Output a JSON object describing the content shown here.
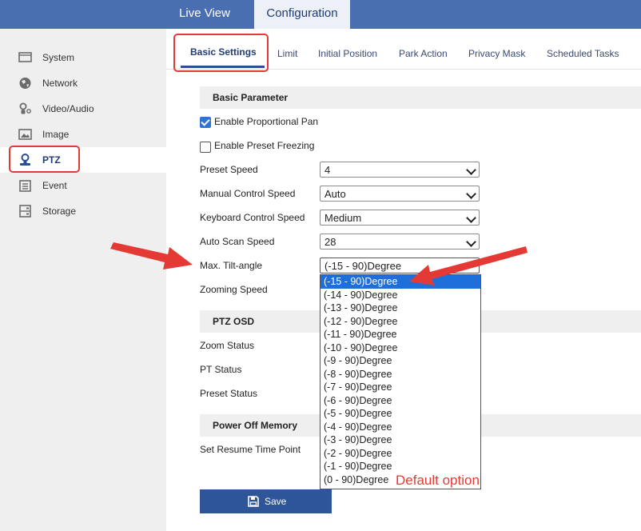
{
  "top_tabs": {
    "live_view": "Live View",
    "configuration": "Configuration"
  },
  "sidebar": {
    "items": [
      {
        "label": "System",
        "icon": "monitor-icon"
      },
      {
        "label": "Network",
        "icon": "globe-icon"
      },
      {
        "label": "Video/Audio",
        "icon": "camera-mic-icon"
      },
      {
        "label": "Image",
        "icon": "image-icon"
      },
      {
        "label": "PTZ",
        "icon": "ptz-icon",
        "active": true
      },
      {
        "label": "Event",
        "icon": "calendar-icon"
      },
      {
        "label": "Storage",
        "icon": "storage-icon"
      }
    ]
  },
  "subtabs": [
    "Basic Settings",
    "Limit",
    "Initial Position",
    "Park Action",
    "Privacy Mask",
    "Scheduled Tasks"
  ],
  "basic_parameter": {
    "title": "Basic Parameter",
    "enable_proportional_pan": {
      "label": "Enable Proportional Pan",
      "checked": true
    },
    "enable_preset_freezing": {
      "label": "Enable Preset Freezing",
      "checked": false
    },
    "preset_speed": {
      "label": "Preset Speed",
      "value": "4"
    },
    "manual_control_speed": {
      "label": "Manual Control Speed",
      "value": "Auto"
    },
    "keyboard_control_speed": {
      "label": "Keyboard Control Speed",
      "value": "Medium"
    },
    "auto_scan_speed": {
      "label": "Auto Scan Speed",
      "value": "28"
    },
    "max_tilt_angle": {
      "label": "Max. Tilt-angle",
      "value": "(-15 - 90)Degree"
    },
    "zooming_speed": {
      "label": "Zooming Speed"
    }
  },
  "tilt_options": [
    "(-15 - 90)Degree",
    "(-14 - 90)Degree",
    "(-13 - 90)Degree",
    "(-12 - 90)Degree",
    "(-11 - 90)Degree",
    "(-10 - 90)Degree",
    "(-9 - 90)Degree",
    "(-8 - 90)Degree",
    "(-7 - 90)Degree",
    "(-6 - 90)Degree",
    "(-5 - 90)Degree",
    "(-4 - 90)Degree",
    "(-3 - 90)Degree",
    "(-2 - 90)Degree",
    "(-1 - 90)Degree",
    "(0 - 90)Degree"
  ],
  "ptz_osd": {
    "title": "PTZ OSD",
    "zoom_status": "Zoom Status",
    "pt_status": "PT Status",
    "preset_status": "Preset Status"
  },
  "power_off_memory": {
    "title": "Power Off Memory",
    "set_resume_time_point": "Set Resume Time Point"
  },
  "save_label": "Save",
  "annotation": {
    "default_option": "Default option"
  },
  "colors": {
    "topbar": "#4a6fb0",
    "accent": "#2e5597",
    "highlight": "#e53935",
    "selected_option": "#1e6fd9"
  }
}
